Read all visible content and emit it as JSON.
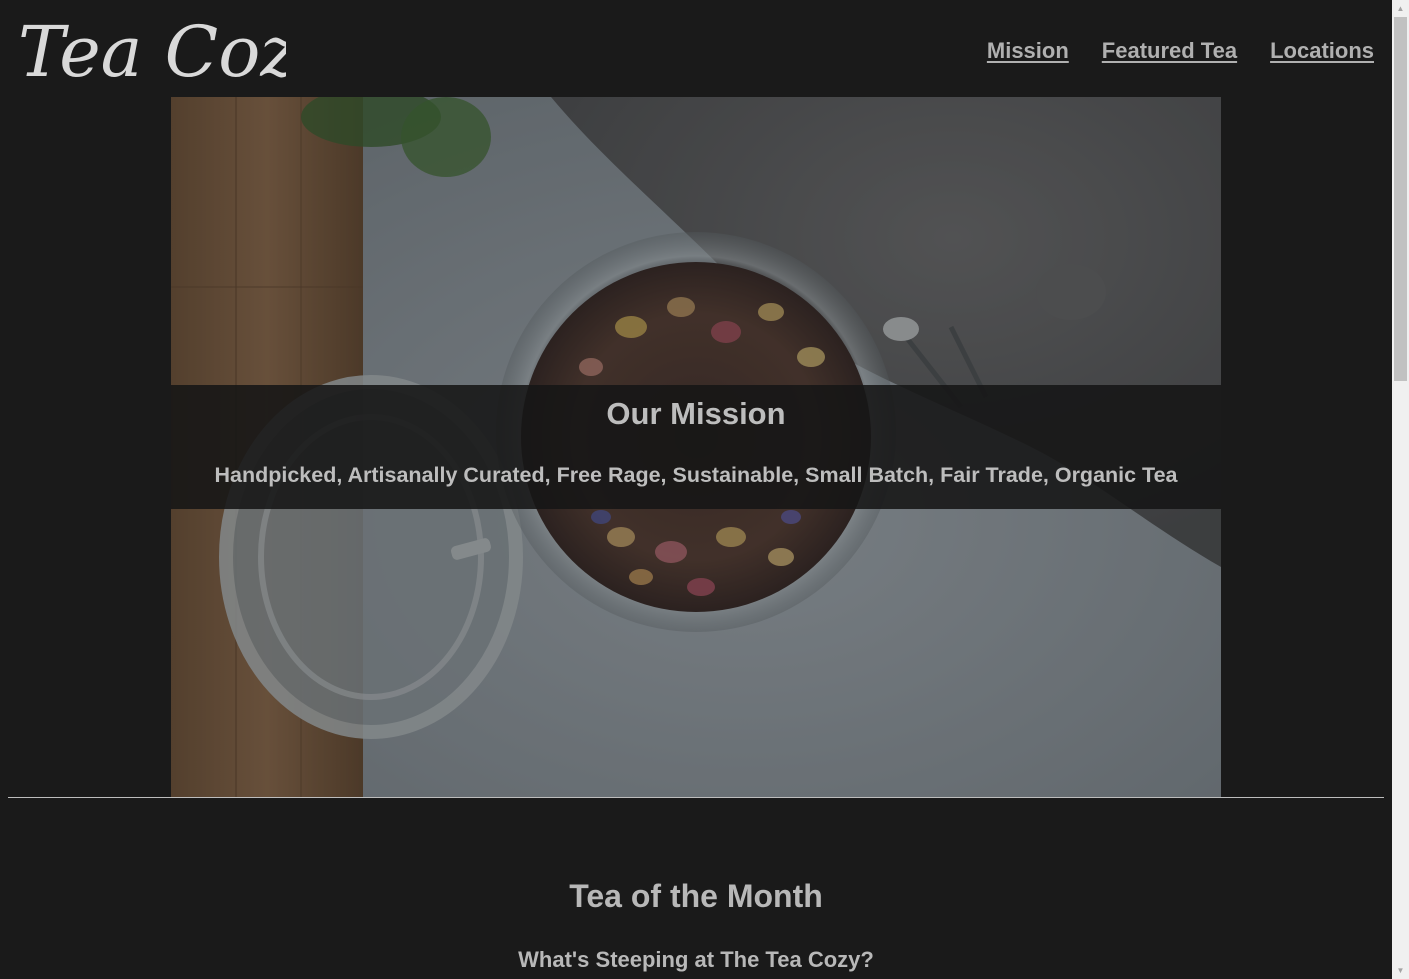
{
  "header": {
    "logo_text": "Tea Cozy",
    "nav": [
      {
        "label": "Mission"
      },
      {
        "label": "Featured Tea"
      },
      {
        "label": "Locations"
      }
    ]
  },
  "hero": {
    "title": "Our Mission",
    "text": "Handpicked, Artisanally Curated, Free Rage, Sustainable, Small Batch, Fair Trade, Organic Tea"
  },
  "featured": {
    "title": "Tea of the Month",
    "subtitle": "What's Steeping at The Tea Cozy?"
  },
  "colors": {
    "background": "#1a1a1a",
    "text": "#b8b8b8",
    "nav_link": "#b0b0b0"
  },
  "icons": {
    "scroll_up": "chevron-up-icon",
    "scroll_down": "chevron-down-icon"
  }
}
